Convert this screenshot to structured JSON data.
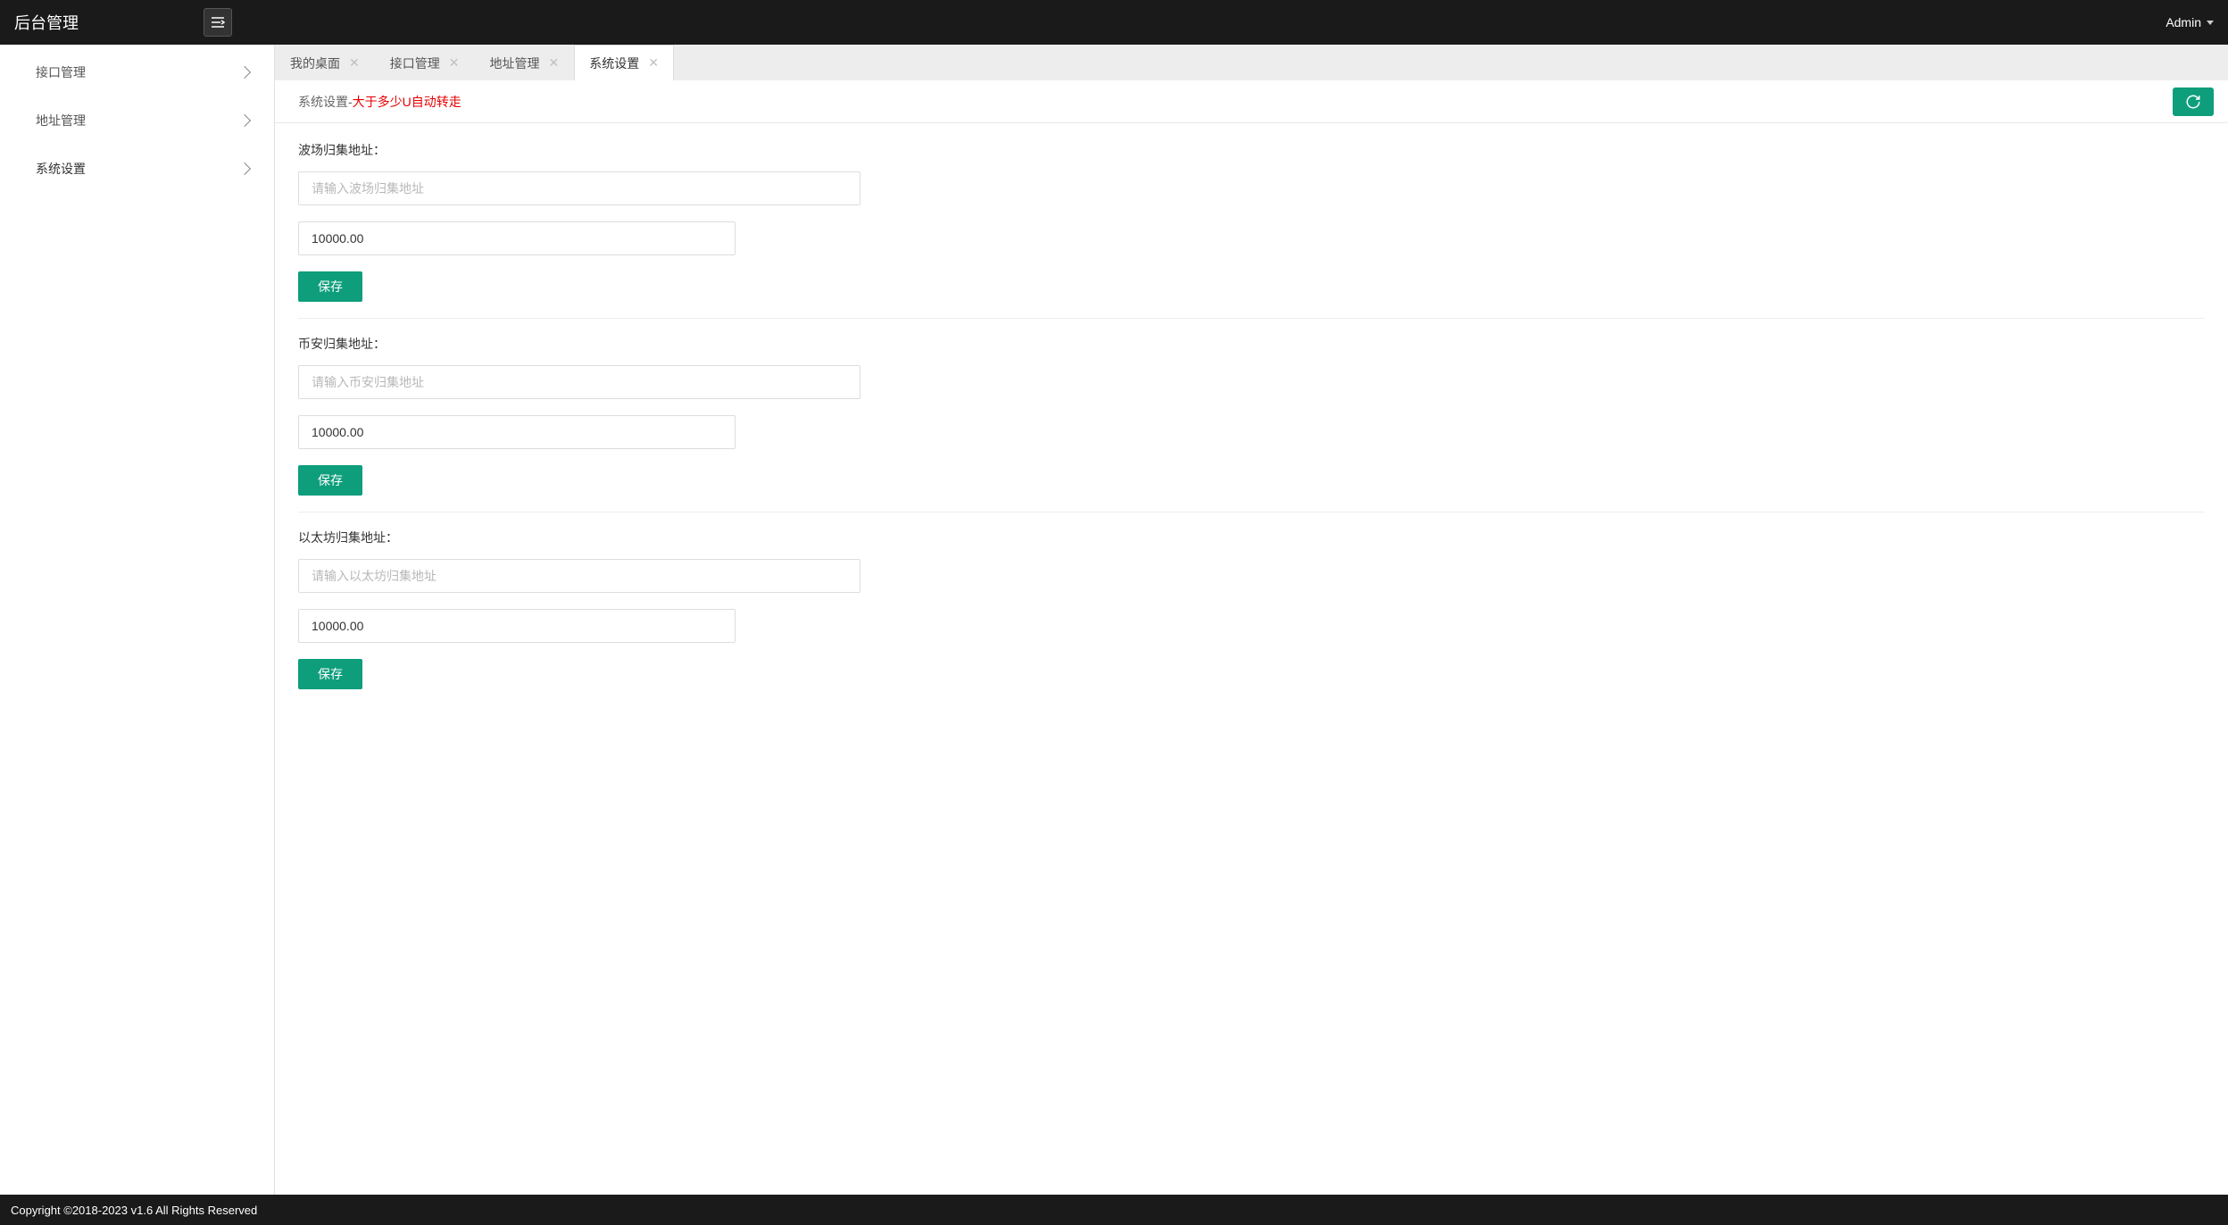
{
  "header": {
    "app_title": "后台管理",
    "user_name": "Admin"
  },
  "sidebar": {
    "items": [
      {
        "label": "接口管理"
      },
      {
        "label": "地址管理"
      },
      {
        "label": "系统设置"
      }
    ]
  },
  "tabs": [
    {
      "label": "我的桌面",
      "active": false
    },
    {
      "label": "接口管理",
      "active": false
    },
    {
      "label": "地址管理",
      "active": false
    },
    {
      "label": "系统设置",
      "active": true
    }
  ],
  "page_header": {
    "title": "系统设置-",
    "subtitle": "大于多少U自动转走"
  },
  "form": {
    "blocks": [
      {
        "label": "波场归集地址：",
        "address_placeholder": "请输入波场归集地址",
        "address_value": "",
        "amount_value": "10000.00",
        "save_label": "保存"
      },
      {
        "label": "币安归集地址：",
        "address_placeholder": "请输入币安归集地址",
        "address_value": "",
        "amount_value": "10000.00",
        "save_label": "保存"
      },
      {
        "label": "以太坊归集地址：",
        "address_placeholder": "请输入以太坊归集地址",
        "address_value": "",
        "amount_value": "10000.00",
        "save_label": "保存"
      }
    ]
  },
  "footer": {
    "text": "Copyright ©2018-2023 v1.6 All Rights Reserved"
  }
}
